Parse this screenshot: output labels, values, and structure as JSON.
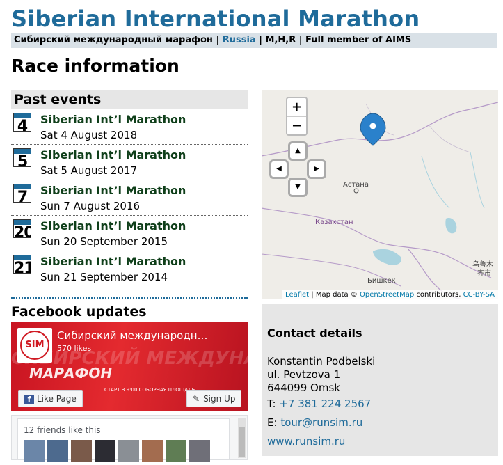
{
  "site": {
    "title": "Siberian International Marathon",
    "subtitle_native": "Сибирский международный марафон",
    "sep1": " | ",
    "country": "Russia",
    "sep2": " | M,H,R | Full member of AIMS"
  },
  "page": {
    "heading": "Race information"
  },
  "past_events": {
    "heading": "Past events",
    "items": [
      {
        "day": "4",
        "title": "Siberian Int’l Marathon",
        "date": "Sat 4 August 2018"
      },
      {
        "day": "5",
        "title": "Siberian Int’l Marathon",
        "date": "Sat 5 August 2017"
      },
      {
        "day": "7",
        "title": "Siberian Int’l Marathon",
        "date": "Sun 7 August 2016"
      },
      {
        "day": "20",
        "title": "Siberian Int’l Marathon",
        "date": "Sun 20 September 2015"
      },
      {
        "day": "21",
        "title": "Siberian Int’l Marathon",
        "date": "Sun 21 September 2014"
      }
    ]
  },
  "map": {
    "zoom_in": "+",
    "zoom_out": "−",
    "pan_up": "▲",
    "pan_left": "◀",
    "pan_right": "▶",
    "pan_down": "▼",
    "labels": {
      "astana": "Астана",
      "kazakhstan": "Казахстан",
      "urumqi_1": "乌鲁木",
      "urumqi_2": "齐市",
      "bishkek": "Бишкек"
    },
    "attribution": {
      "leaflet": "Leaflet",
      "text1": " | Map data © ",
      "osm": "OpenStreetMap",
      "text2": " contributors, ",
      "license": "CC-BY-SA"
    },
    "pin_color": "#2a81cb"
  },
  "facebook": {
    "heading": "Facebook updates",
    "logo_text": "SIM",
    "page_name": "Сибирский международн…",
    "likes": "570 likes",
    "cover_text_1": "СИБИРСКИЙ МЕЖДУНАРОДНЫЙ",
    "cover_text_2": "МАРАФОН",
    "cover_small": "СТАРТ В 9:00  СОБОРНАЯ ПЛОЩАДЬ",
    "like_label": "Like Page",
    "signup_label": "Sign Up",
    "friends_text": "12 friends like this"
  },
  "contact": {
    "heading": "Contact details",
    "name": "Konstantin Podbelski",
    "address1": "ul. Pevtzova 1",
    "address2": "644099 Omsk",
    "phone_label": "T:",
    "phone": "+7 381 224 2567",
    "email_label": "E:",
    "email": "tour@runsim.ru",
    "website": "www.runsim.ru"
  },
  "colors": {
    "brand_blue": "#1f6b9a",
    "event_title": "#0f3f1a",
    "fb_red": "#d01a23"
  }
}
